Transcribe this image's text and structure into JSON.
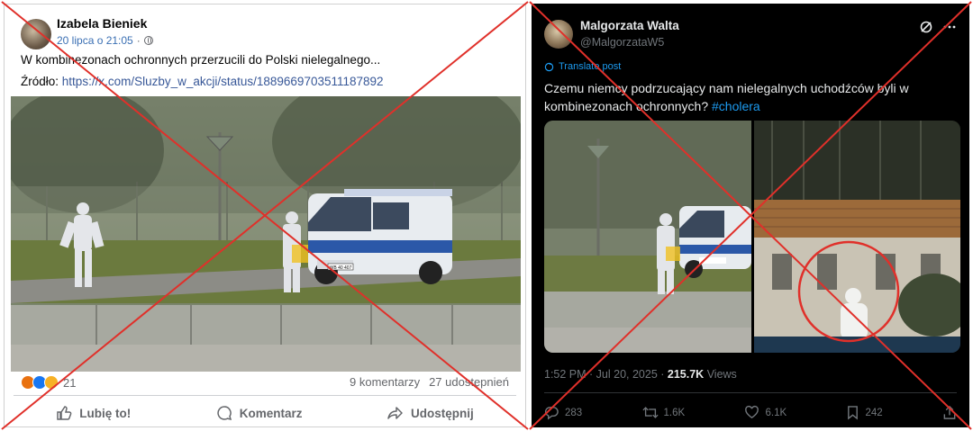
{
  "facebook": {
    "author": "Izabela Bieniek",
    "date": "20 lipca o 21:05",
    "separator": "·",
    "text": "W kombinezonach ochronnych przerzucili do Polski nielegalnego...",
    "source_label": "Źródło:",
    "source_link": "https://x.com/Sluzby_w_akcji/status/1889669703511187892",
    "reactions_count": "21",
    "comments": "9 komentarzy",
    "shares": "27 udostępnień",
    "actions": {
      "like": "Lubię to!",
      "comment": "Komentarz",
      "share": "Udostępnij"
    },
    "photo": {
      "van_plate": "WB 40 407"
    }
  },
  "twitter": {
    "author": "Malgorzata Walta",
    "handle": "@MalgorzataW5",
    "translate": "Translate post",
    "text": "Czemu niemcy podrzucający nam nielegalnych uchodźców byli w kombinezonach ochronnych?",
    "hashtag": "#cholera",
    "time": "1:52 PM · Jul 20, 2025 ·",
    "views_count": "215.7K",
    "views_label": "Views",
    "replies": "283",
    "reposts": "1.6K",
    "likes": "6.1K",
    "bookmarks": "242"
  },
  "colors": {
    "fact_check_cross": "#e0302a",
    "fb_link": "#385898",
    "tw_link": "#1d9bf0"
  },
  "icons": [
    "globe-icon",
    "like-icon",
    "comment-icon",
    "share-icon",
    "grok-icon",
    "more-icon",
    "translate-icon",
    "reply-icon",
    "repost-icon",
    "heart-icon",
    "bookmark-icon",
    "upload-icon"
  ]
}
